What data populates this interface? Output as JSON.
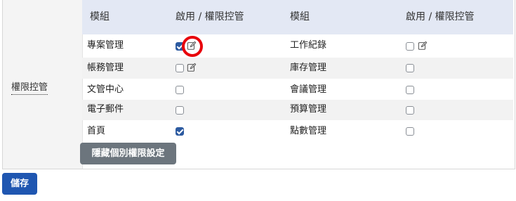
{
  "section_label": "權限控管",
  "header": {
    "col1": "模組",
    "col2": "啟用 / 權限控管",
    "col3": "模組",
    "col4": "啟用 / 權限控管"
  },
  "rows": [
    {
      "left_module": "專案管理",
      "left_checked": true,
      "left_edit": true,
      "right_module": "工作紀錄",
      "right_checked": false,
      "right_edit": true
    },
    {
      "left_module": "帳務管理",
      "left_checked": false,
      "left_edit": true,
      "right_module": "庫存管理",
      "right_checked": false,
      "right_edit": false
    },
    {
      "left_module": "文管中心",
      "left_checked": false,
      "left_edit": false,
      "right_module": "會議管理",
      "right_checked": false,
      "right_edit": false
    },
    {
      "left_module": "電子郵件",
      "left_checked": false,
      "left_edit": false,
      "right_module": "預算管理",
      "right_checked": false,
      "right_edit": false
    },
    {
      "left_module": "首頁",
      "left_checked": true,
      "left_edit": false,
      "right_module": "點數管理",
      "right_checked": false,
      "right_edit": false
    }
  ],
  "buttons": {
    "hide_label": "隱藏個別權限設定",
    "save_label": "儲存"
  },
  "colors": {
    "header_bg": "#e3e8f4",
    "checked": "#2c5aa0",
    "highlight": "#e8000b",
    "save_btn": "#1f56b1",
    "hide_btn": "#6c757d"
  }
}
